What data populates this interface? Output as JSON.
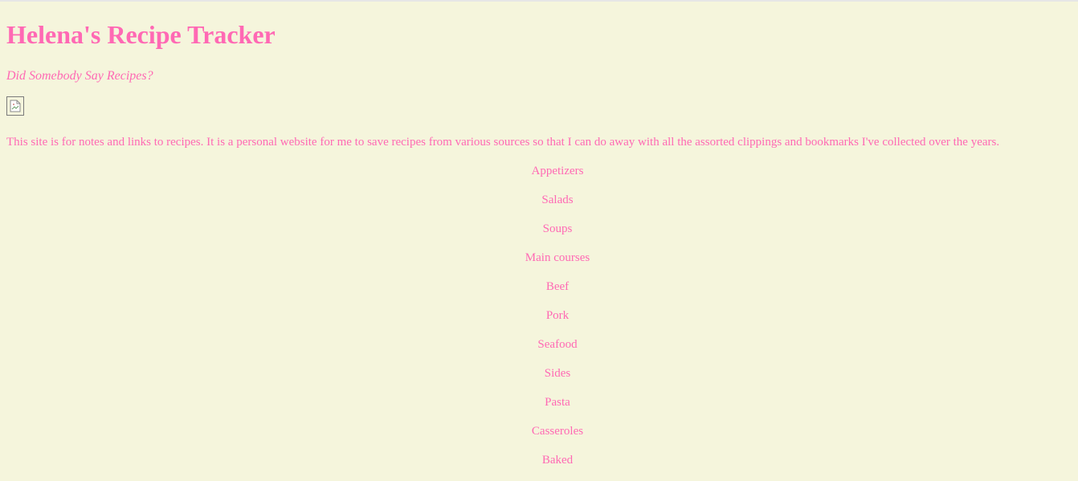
{
  "header": {
    "title": "Helena's Recipe Tracker",
    "tagline": "Did Somebody Say Recipes?"
  },
  "image": {
    "icon": "broken-image-icon"
  },
  "intro": {
    "text": "This site is for notes and links to recipes. It is a personal website for me to save recipes from various sources so that I can do away with all the assorted clippings and bookmarks I've collected over the years."
  },
  "nav": {
    "items": [
      {
        "label": "Appetizers"
      },
      {
        "label": "Salads"
      },
      {
        "label": "Soups"
      },
      {
        "label": "Main courses"
      },
      {
        "label": "Beef"
      },
      {
        "label": "Pork"
      },
      {
        "label": "Seafood"
      },
      {
        "label": "Sides"
      },
      {
        "label": "Pasta"
      },
      {
        "label": "Casseroles"
      },
      {
        "label": "Baked"
      }
    ]
  },
  "colors": {
    "background": "#f5f5dc",
    "text": "#ff69b4"
  }
}
